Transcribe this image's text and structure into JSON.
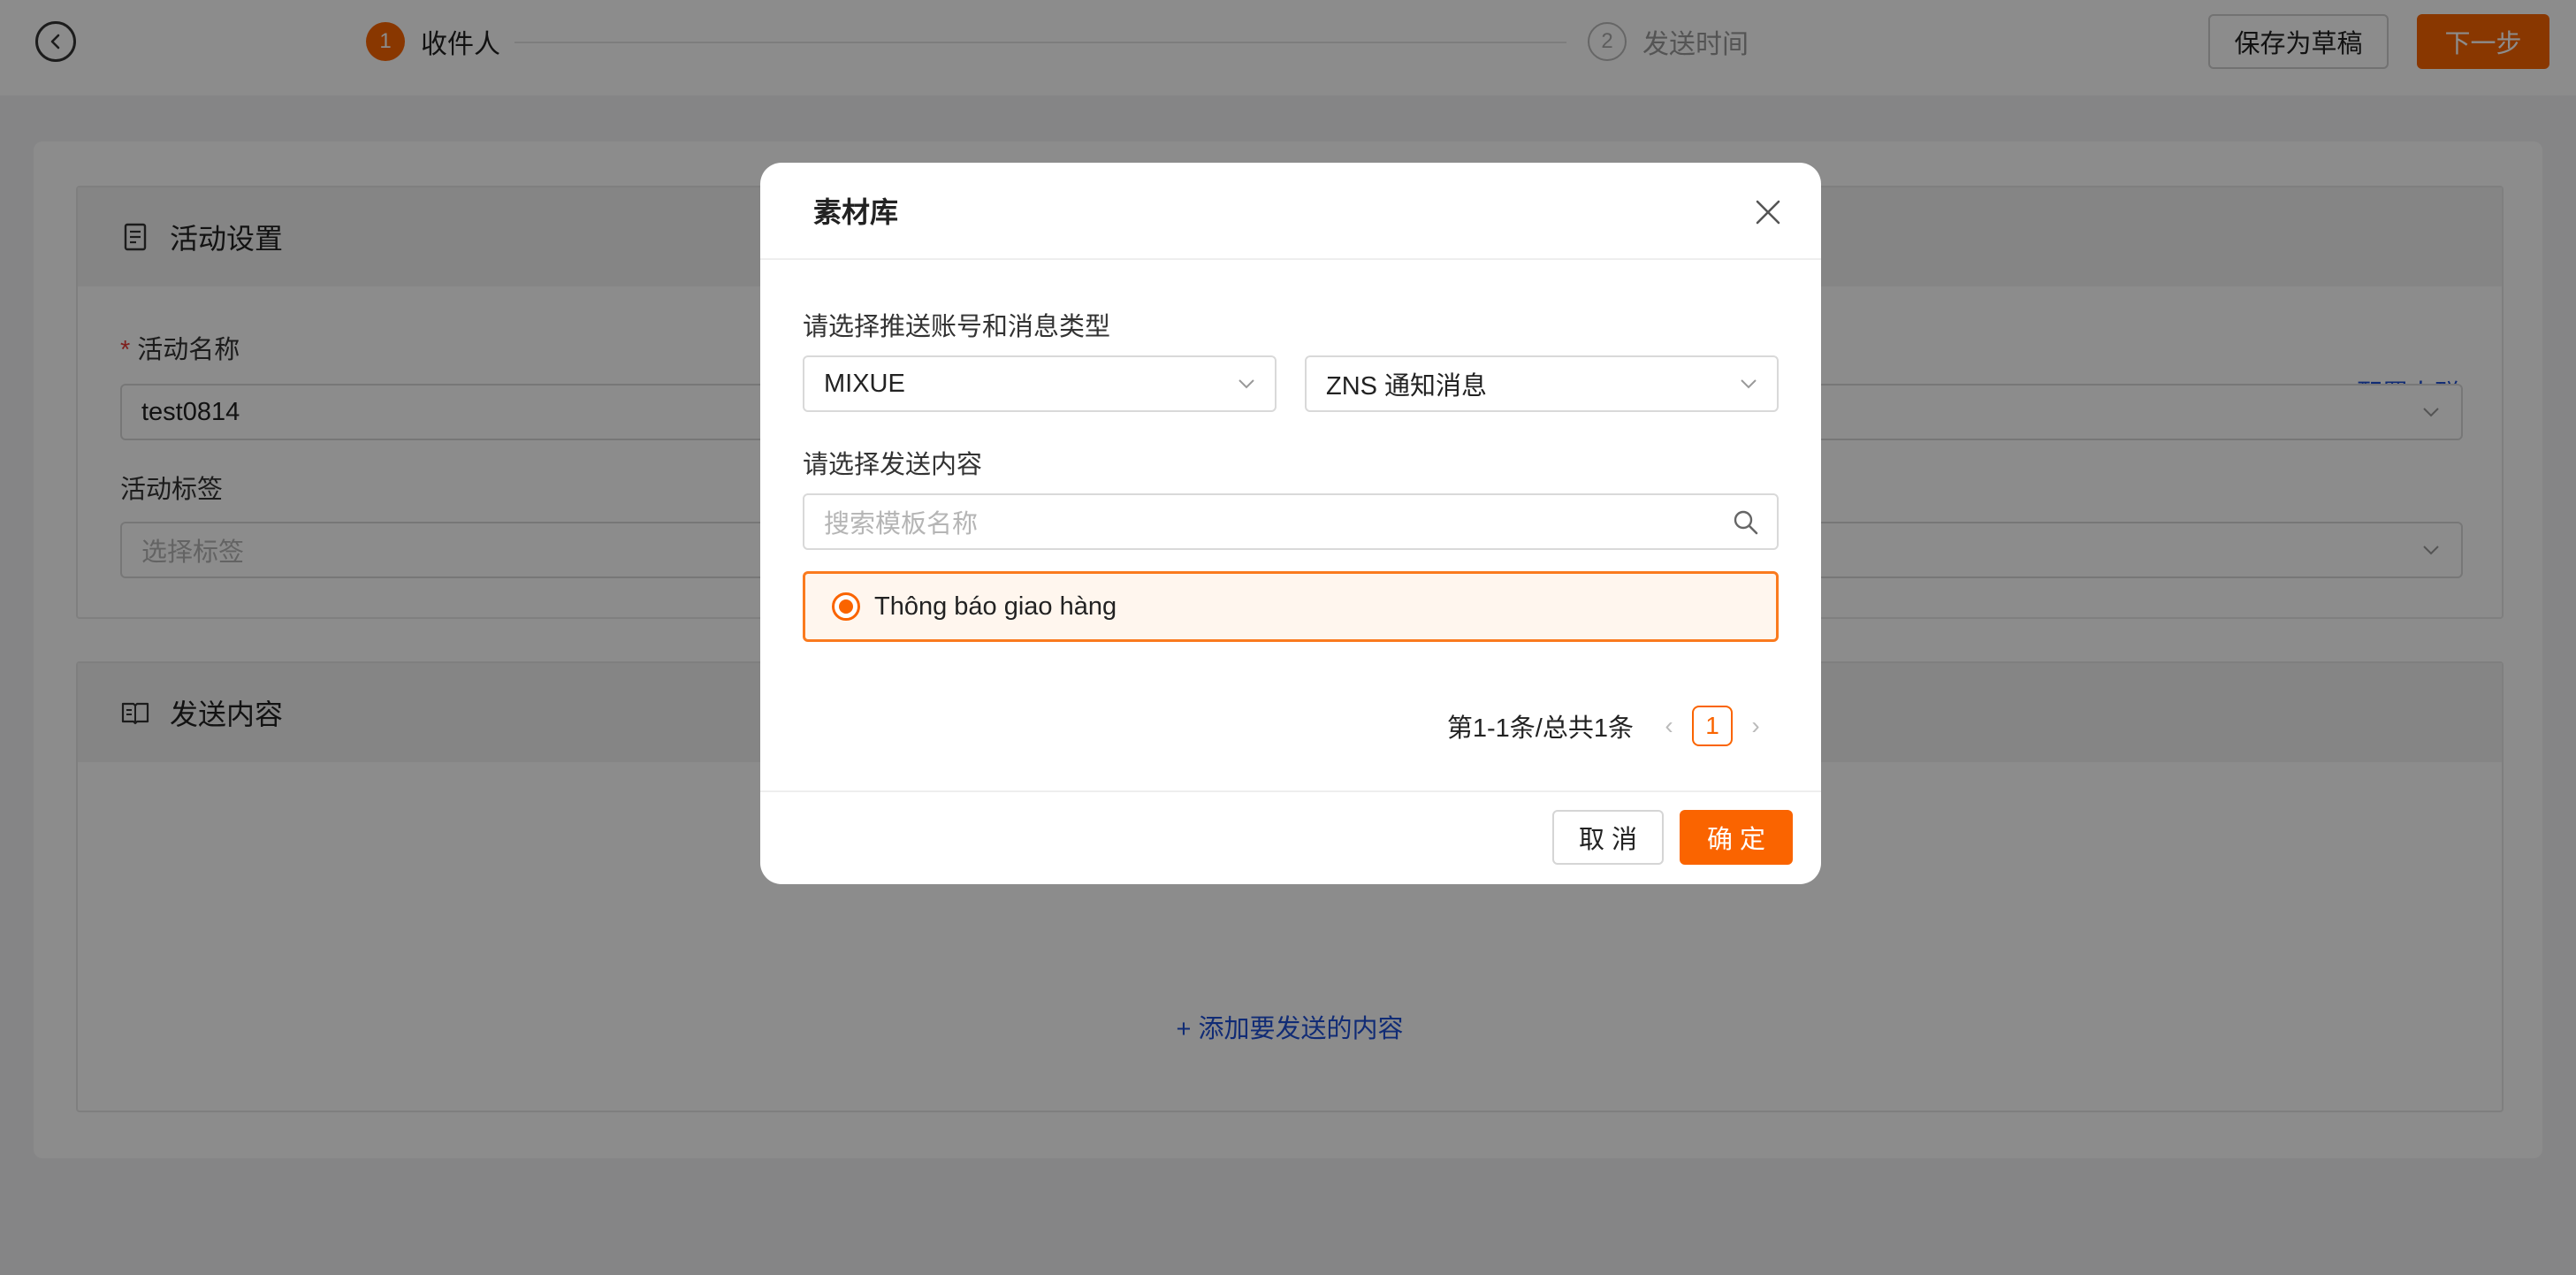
{
  "header": {
    "steps": [
      {
        "number": "1",
        "label": "收件人"
      },
      {
        "number": "2",
        "label": "发送时间"
      }
    ],
    "save_draft_label": "保存为草稿",
    "next_label": "下一步"
  },
  "activity_settings": {
    "title": "活动设置",
    "name_label": "活动名称",
    "name_required_mark": "*",
    "name_value": "test0814",
    "tag_label": "活动标签",
    "tag_placeholder": "选择标签",
    "config_audience_link": "配置人群"
  },
  "send_content": {
    "title": "发送内容",
    "add_link": "+ 添加要发送的内容"
  },
  "modal": {
    "title": "素材库",
    "account_label": "请选择推送账号和消息类型",
    "account_value": "MIXUE",
    "type_value": "ZNS 通知消息",
    "content_label": "请选择发送内容",
    "search_placeholder": "搜索模板名称",
    "templates": [
      {
        "name": "Thông báo giao hàng",
        "selected": true
      }
    ],
    "pagination": {
      "summary": "第1-1条/总共1条",
      "current_page": "1"
    },
    "cancel_label": "取 消",
    "confirm_label": "确 定"
  },
  "colors": {
    "accent": "#fa6400",
    "link": "#1e4fd6"
  }
}
